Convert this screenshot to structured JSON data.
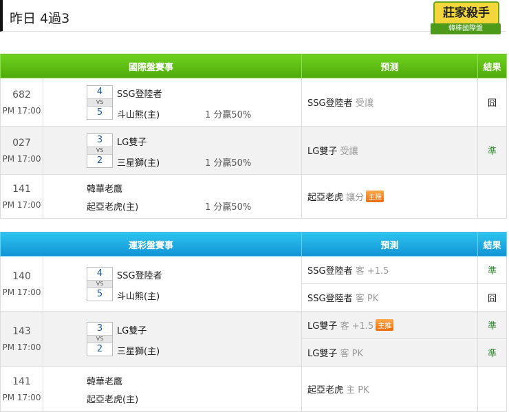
{
  "title": "昨日 4過3",
  "logo": {
    "main": "莊家殺手",
    "sub": "韓棒國際盤"
  },
  "intl": {
    "headers": [
      "國際盤賽事",
      "预测",
      "結果"
    ],
    "rows": [
      {
        "id": "682",
        "time": "PM 17:00",
        "away_score": "4",
        "home_score": "5",
        "vs": "VS",
        "away": "SSG登陸者",
        "home": "斗山熊(主)",
        "odds": "1 分贏50%",
        "pick": "SSG登陸者",
        "pick_note": "受讓",
        "result": "囧"
      },
      {
        "id": "027",
        "time": "PM 17:00",
        "away_score": "3",
        "home_score": "2",
        "vs": "VS",
        "away": "LG雙子",
        "home": "三星獅(主)",
        "odds": "1 分贏50%",
        "pick": "LG雙子",
        "pick_note": "受讓",
        "result": "準"
      },
      {
        "id": "141",
        "time": "PM 17:00",
        "away": "韓華老鷹",
        "home": "起亞老虎(主)",
        "odds": "1 分贏50%",
        "pick": "起亞老虎",
        "pick_note": "讓分",
        "badge": "主推",
        "result": ""
      }
    ]
  },
  "sport": {
    "headers": [
      "運彩盤賽事",
      "預測",
      "結果"
    ],
    "rows": [
      {
        "id": "140",
        "time": "PM 17:00",
        "away_score": "4",
        "home_score": "5",
        "vs": "VS",
        "away": "SSG登陸者",
        "home": "斗山熊(主)",
        "picks": [
          {
            "team": "SSG登陸者",
            "note": "客 +1.5",
            "result": "準"
          },
          {
            "team": "SSG登陸者",
            "note": "客 PK",
            "result": "囧"
          }
        ]
      },
      {
        "id": "143",
        "time": "PM 17:00",
        "away_score": "3",
        "home_score": "2",
        "vs": "VS",
        "away": "LG雙子",
        "home": "三星獅(主)",
        "picks": [
          {
            "team": "LG雙子",
            "note": "客 +1.5",
            "badge": "主推",
            "result": "準"
          },
          {
            "team": "LG雙子",
            "note": "客 PK",
            "result": "準"
          }
        ]
      },
      {
        "id": "141",
        "time": "PM 17:00",
        "away": "韓華老鷹",
        "home": "起亞老虎(主)",
        "picks": [
          {
            "team": "起亞老虎",
            "note": "主 PK",
            "result": ""
          }
        ]
      }
    ]
  },
  "colors": {
    "intl_header": "#5cbf12",
    "sport_header": "#1aa8e2",
    "badge": "#f08020",
    "ok": "#2a8a2a"
  }
}
